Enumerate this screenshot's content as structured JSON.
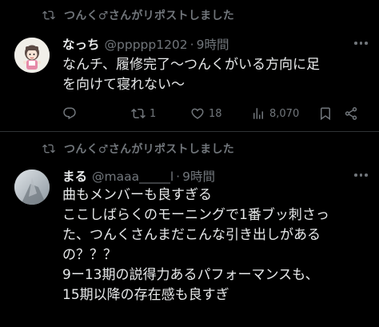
{
  "tweets": [
    {
      "repost_label": "つんく♂さんがリポストしました",
      "display_name": "なっち",
      "handle": "@ppppp1202",
      "separator": "·",
      "time": "9時間",
      "text": "なんチ、履修完了〜つんくがいる方向に足\nを向けて寝れない〜",
      "reply_count": "",
      "retweet_count": "1",
      "like_count": "18",
      "view_count": "8,070"
    },
    {
      "repost_label": "つんく♂さんがリポストしました",
      "display_name": "まる",
      "handle": "@maaa_____l",
      "separator": "·",
      "time": "9時間",
      "text": "曲もメンバーも良すぎる\nここしばらくのモーニングで1番ブッ刺さっ\nた、つんくさんまだこんな引き出しがある\nの？？？\n9ー13期の説得力あるパフォーマンスも、\n15期以降の存在感も良すぎ"
    }
  ],
  "icons": {
    "repost": "repost-icon",
    "reply": "reply-icon",
    "like": "heart-icon",
    "views": "views-icon",
    "bookmark": "bookmark-icon",
    "share": "share-icon",
    "more": "more-icon"
  },
  "colors": {
    "background": "#000000",
    "text": "#e7e9ea",
    "muted": "#71767b",
    "divider": "#2f3336"
  }
}
